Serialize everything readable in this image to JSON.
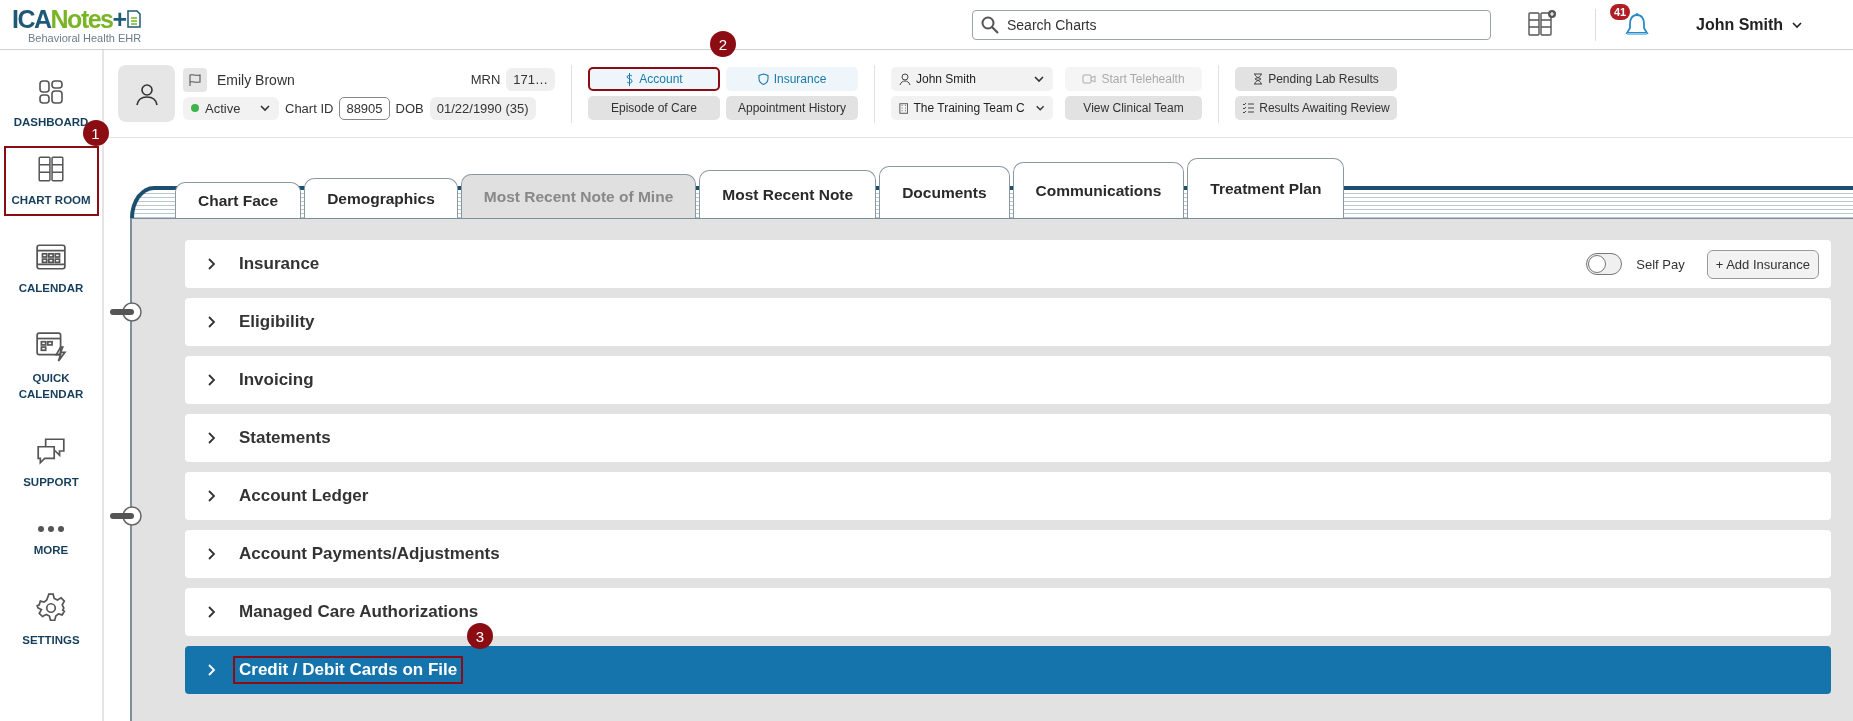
{
  "header": {
    "logo": {
      "brand_dark": "ICA",
      "brand_green": "Notes",
      "plus": "+",
      "subtitle": "Behavioral Health EHR"
    },
    "search": {
      "placeholder": "Search Charts"
    },
    "notifications": {
      "count": "41"
    },
    "user": {
      "name": "John Smith"
    }
  },
  "sidebar": {
    "items": [
      {
        "label": "DASHBOARD",
        "kind": "dashboard"
      },
      {
        "label": "CHART ROOM",
        "kind": "chartroom",
        "callout": "1"
      },
      {
        "label": "CALENDAR",
        "kind": "calendar"
      },
      {
        "label": "QUICK CALENDAR",
        "kind": "quickcalendar"
      },
      {
        "label": "SUPPORT",
        "kind": "support"
      },
      {
        "label": "MORE",
        "kind": "more"
      },
      {
        "label": "SETTINGS",
        "kind": "settings"
      }
    ]
  },
  "patient": {
    "name": "Emily Brown",
    "mrn_label": "MRN",
    "mrn": "171…",
    "status": "Active",
    "chart_id_label": "Chart ID",
    "chart_id": "88905",
    "dob_label": "DOB",
    "dob": "01/22/1990 (35)"
  },
  "patient_actions": [
    {
      "label": "Account",
      "kind": "primary",
      "callout": "2"
    },
    {
      "label": "Insurance",
      "kind": "primary"
    },
    {
      "label": "Episode of Care",
      "kind": "secondary"
    },
    {
      "label": "Appointment History",
      "kind": "secondary"
    }
  ],
  "care_team": {
    "provider": "John Smith",
    "team": "The Training Team C",
    "buttons": [
      {
        "label": "Start Telehealth",
        "disabled": true
      },
      {
        "label": "View Clinical Team",
        "disabled": false
      }
    ]
  },
  "results": [
    {
      "label": "Pending Lab Results",
      "kind": "pending"
    },
    {
      "label": "Results Awaiting Review",
      "kind": "review"
    }
  ],
  "tabs": [
    {
      "label": "Chart Face",
      "disabled": false
    },
    {
      "label": "Demographics",
      "disabled": false
    },
    {
      "label": "Most Recent Note of Mine",
      "disabled": true
    },
    {
      "label": "Most Recent Note",
      "disabled": false
    },
    {
      "label": "Documents",
      "disabled": false
    },
    {
      "label": "Communications",
      "disabled": false
    },
    {
      "label": "Treatment Plan",
      "disabled": false
    }
  ],
  "sections": [
    {
      "title": "Insurance",
      "highlighted": false,
      "controls": {
        "self_pay": {
          "label": "Self Pay",
          "on": false
        },
        "add_button": "+ Add Insurance"
      }
    },
    {
      "title": "Eligibility",
      "highlighted": false
    },
    {
      "title": "Invoicing",
      "highlighted": false
    },
    {
      "title": "Statements",
      "highlighted": false
    },
    {
      "title": "Account Ledger",
      "highlighted": false
    },
    {
      "title": "Account Payments/Adjustments",
      "highlighted": false
    },
    {
      "title": "Managed Care Authorizations",
      "highlighted": false
    },
    {
      "title": "Credit / Debit Cards on File",
      "highlighted": true,
      "callout": "3"
    }
  ]
}
